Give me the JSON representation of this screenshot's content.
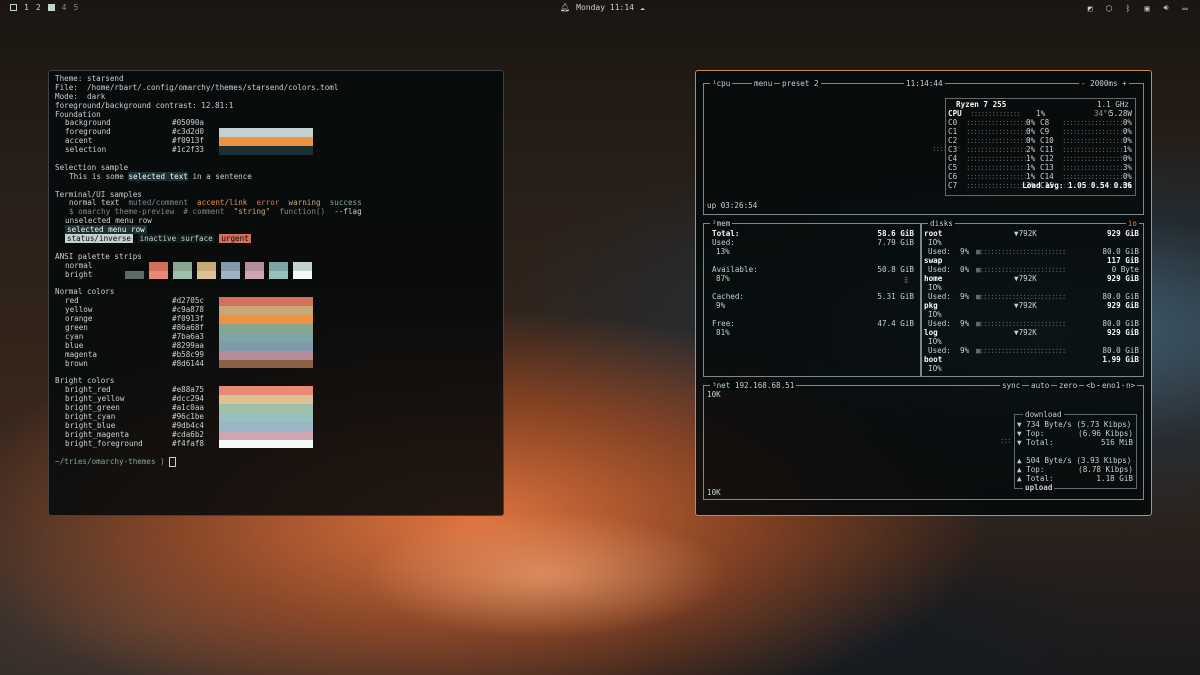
{
  "topbar": {
    "workspaces": [
      "1",
      "2",
      "4",
      "5"
    ],
    "clock": "Monday 11:14",
    "tray_icons": [
      "omarchy-icon",
      "update-icon",
      "bluetooth-icon",
      "network-icon",
      "volume-icon",
      "battery-icon"
    ]
  },
  "theme_terminal": {
    "header": [
      "Theme: starsend",
      "File:  /home/rbart/.config/omarchy/themes/starsend/colors.toml",
      "Mode:  dark",
      "foreground/background contrast: 12.81:1"
    ],
    "foundation_title": "Foundation",
    "foundation": [
      {
        "name": "background",
        "hex": "#05090a"
      },
      {
        "name": "foreground",
        "hex": "#c3d2d0"
      },
      {
        "name": "accent",
        "hex": "#f0913f"
      },
      {
        "name": "selection",
        "hex": "#1c2f33"
      }
    ],
    "selection_title": "Selection sample",
    "selection_before": "This is some ",
    "selection_word": "selected text",
    "selection_after": " in a sentence",
    "ui_title": "Terminal/UI samples",
    "ui_normal": "normal text",
    "ui_muted": "muted/comment",
    "ui_accent": "accent/link",
    "ui_error": "error",
    "ui_warning": "warning",
    "ui_success": "success",
    "ui_cmd": "$ omarchy theme-preview",
    "ui_comment": "# comment",
    "ui_string": "\"string\"",
    "ui_func": "function()",
    "ui_flag": "--flag",
    "ui_unselected": "unselected menu row",
    "ui_selected": "selected menu row",
    "ui_inverse": "status/inverse",
    "ui_inactive": "inactive surface",
    "ui_urgent": "urgent",
    "ansi_title": "ANSI palette strips",
    "ansi_normal_label": "normal",
    "ansi_bright_label": "bright",
    "ansi_normal": [
      "#05090a",
      "#d2705c",
      "#86a68f",
      "#c9a878",
      "#8299aa",
      "#b58c99",
      "#7ba6a3",
      "#c3d2d0"
    ],
    "ansi_bright": [
      "#5c6a69",
      "#e88a75",
      "#a1c0aa",
      "#dcc294",
      "#9db4c4",
      "#cda6b2",
      "#96c1be",
      "#f4faf8"
    ],
    "normal_title": "Normal colors",
    "normal": [
      {
        "name": "red",
        "hex": "#d2705c"
      },
      {
        "name": "yellow",
        "hex": "#c9a878"
      },
      {
        "name": "orange",
        "hex": "#f0913f"
      },
      {
        "name": "green",
        "hex": "#86a68f"
      },
      {
        "name": "cyan",
        "hex": "#7ba6a3"
      },
      {
        "name": "blue",
        "hex": "#8299aa"
      },
      {
        "name": "magenta",
        "hex": "#b58c99"
      },
      {
        "name": "brown",
        "hex": "#8d6144"
      }
    ],
    "bright_title": "Bright colors",
    "bright": [
      {
        "name": "bright_red",
        "hex": "#e88a75"
      },
      {
        "name": "bright_yellow",
        "hex": "#dcc294"
      },
      {
        "name": "bright_green",
        "hex": "#a1c0aa"
      },
      {
        "name": "bright_cyan",
        "hex": "#96c1be"
      },
      {
        "name": "bright_blue",
        "hex": "#9db4c4"
      },
      {
        "name": "bright_magenta",
        "hex": "#cda6b2"
      },
      {
        "name": "bright_foreground",
        "hex": "#f4faf8"
      }
    ],
    "prompt": "~/tries/omarchy-themes",
    "prompt_symbol": ")"
  },
  "btop": {
    "cpu_label": "¹cpu",
    "menu_label": "menu",
    "preset_label": "preset 2",
    "time": "11:14:44",
    "interval": "- 2000ms +",
    "uptime": "up 03:26:54",
    "cpu_model": "Ryzen 7 255",
    "cpu_freq": "1.1 GHz",
    "cpu_total_label": "CPU",
    "cpu_total_pct": "1%",
    "cpu_temp": "34°C",
    "cpu_power": "5.28W",
    "cores_left": [
      {
        "name": "C0",
        "pct": "0%"
      },
      {
        "name": "C1",
        "pct": "0%"
      },
      {
        "name": "C2",
        "pct": "0%"
      },
      {
        "name": "C3",
        "pct": "2%"
      },
      {
        "name": "C4",
        "pct": "1%"
      },
      {
        "name": "C5",
        "pct": "1%"
      },
      {
        "name": "C6",
        "pct": "1%"
      },
      {
        "name": "C7",
        "pct": "2%"
      }
    ],
    "cores_right": [
      {
        "name": "C8",
        "pct": "0%"
      },
      {
        "name": "C9",
        "pct": "0%"
      },
      {
        "name": "C10",
        "pct": "0%"
      },
      {
        "name": "C11",
        "pct": "1%"
      },
      {
        "name": "C12",
        "pct": "0%"
      },
      {
        "name": "C13",
        "pct": "3%"
      },
      {
        "name": "C14",
        "pct": "0%"
      },
      {
        "name": "C15",
        "pct": "0%"
      }
    ],
    "load_avg": "Load avg: 1.05 0.54 0.36",
    "mem_label": "²mem",
    "mem_total_label": "Total:",
    "mem_total": "58.6 GiB",
    "mem_used_label": "Used:",
    "mem_used": "7.79 GiB",
    "mem_used_pct": "13%",
    "mem_avail_label": "Available:",
    "mem_avail": "50.8 GiB",
    "mem_avail_pct": "87%",
    "mem_cached_label": "Cached:",
    "mem_cached": "5.31 GiB",
    "mem_cached_pct": "9%",
    "mem_free_label": "Free:",
    "mem_free": "47.4 GiB",
    "mem_free_pct": "81%",
    "disks_label": "disks",
    "io_label": "io",
    "disks": [
      {
        "name": "root",
        "io": "▼792K",
        "size": "929 GiB",
        "used_pct": "9%",
        "free": "80.0 GiB"
      },
      {
        "name": "swap",
        "io": "",
        "size": "117 GiB",
        "used_pct": "0%",
        "free": "0 Byte"
      },
      {
        "name": "home",
        "io": "▼792K",
        "size": "929 GiB",
        "used_pct": "9%",
        "free": "80.0 GiB"
      },
      {
        "name": "pkg",
        "io": "▼792K",
        "size": "929 GiB",
        "used_pct": "9%",
        "free": "80.0 GiB"
      },
      {
        "name": "log",
        "io": "▼792K",
        "size": "929 GiB",
        "used_pct": "9%",
        "free": "80.0 GiB"
      },
      {
        "name": "boot",
        "io": "",
        "size": "1.99 GiB",
        "used_pct": "",
        "free": ""
      }
    ],
    "io_word": "IO%",
    "used_word": "Used:",
    "net_label": "³net",
    "net_ip": "192.168.68.51",
    "net_sync": "sync",
    "net_auto": "auto",
    "net_zero": "zero",
    "net_b": "<b",
    "net_iface": "eno1",
    "net_n": "n>",
    "net_scale_top": "10K",
    "net_scale_bottom": "10K",
    "download_title": "download",
    "dl_rate": "▼ 734 Byte/s (5.73 Kibps)",
    "dl_top_label": "▼ Top:",
    "dl_top": "(6.96 Kibps)",
    "dl_total_label": "▼ Total:",
    "dl_total": "516 MiB",
    "ul_rate": "▲ 504 Byte/s (3.93 Kibps)",
    "ul_top_label": "▲ Top:",
    "ul_top": "(8.78 Kibps)",
    "ul_total_label": "▲ Total:",
    "ul_total": "1.18 GiB",
    "upload_title": "upload"
  }
}
